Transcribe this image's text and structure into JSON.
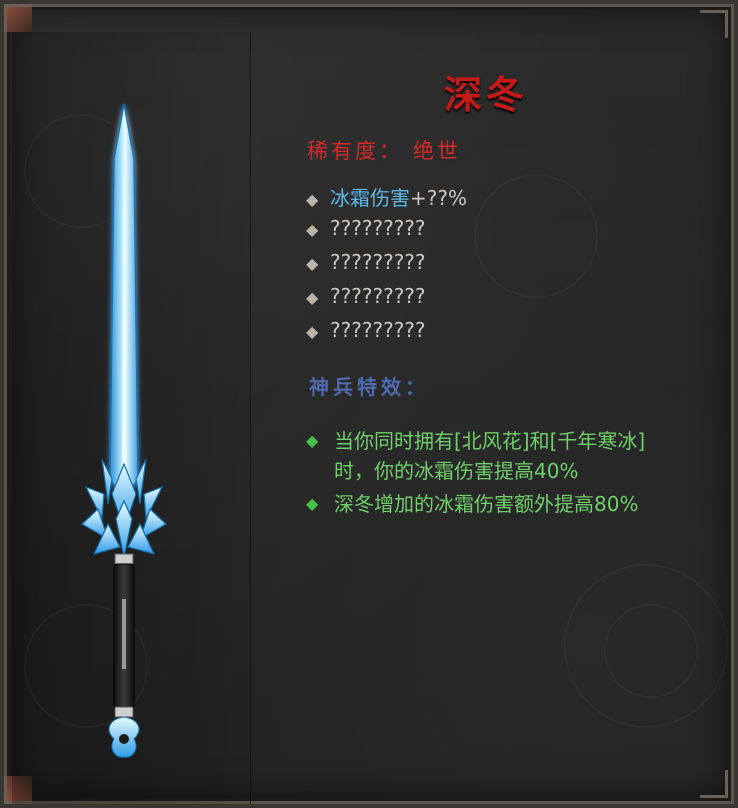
{
  "item": {
    "name": "深冬",
    "rarity_label": "稀有度：",
    "rarity_value": "绝世"
  },
  "stats": [
    {
      "name": "冰霜伤害",
      "value": "+??%"
    },
    {
      "name": "?????????"
    },
    {
      "name": "?????????"
    },
    {
      "name": "?????????"
    },
    {
      "name": "?????????"
    }
  ],
  "effects_title": "神兵特效：",
  "effects": [
    {
      "line1": "当你同时拥有[北风花]和[千年寒冰]",
      "line2": "时，你的冰霜伤害提高40%"
    },
    {
      "line1": "深冬增加的冰霜伤害额外提高80%"
    }
  ],
  "colors": {
    "title": "#c41a1a",
    "rarity": "#d62a2a",
    "frost_stat": "#5bb9e8",
    "effect_text": "#6fcf6a",
    "effect_heading": "#4f6ab0"
  },
  "icons": {
    "weapon": "ice-sword-icon",
    "stat_bullet": "diamond-bullet-icon",
    "effect_bullet": "green-diamond-bullet-icon"
  }
}
